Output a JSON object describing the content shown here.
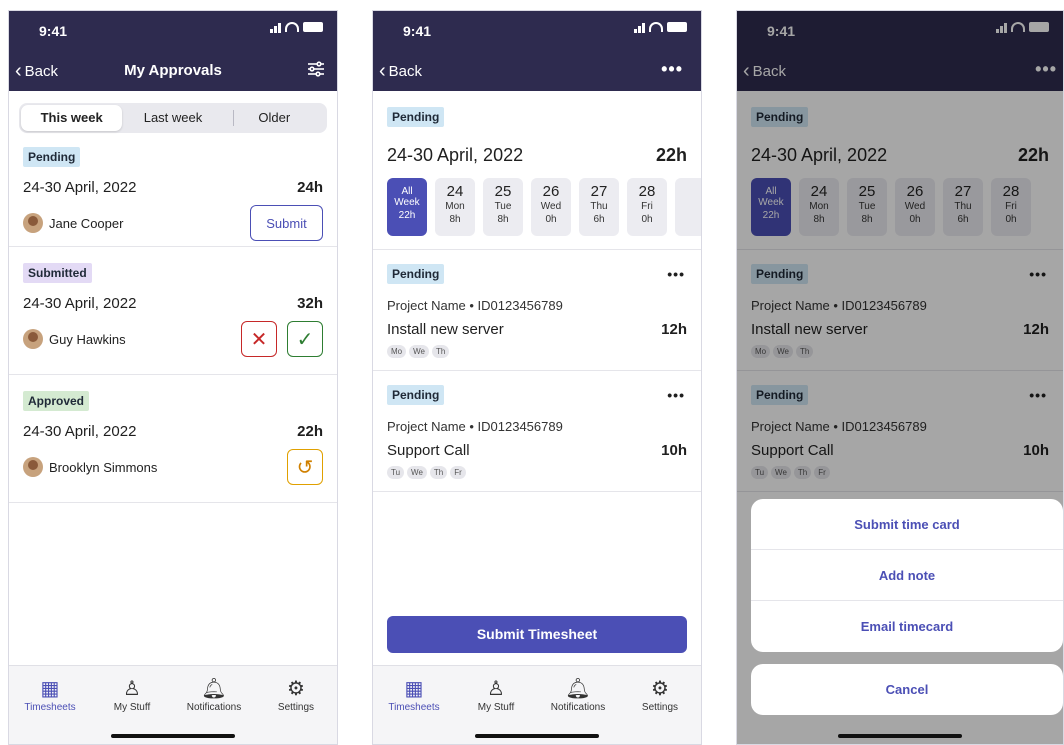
{
  "colors": {
    "navy": "#2e2b4f",
    "accent": "#4b4fb5"
  },
  "status": {
    "time": "9:41"
  },
  "nav": {
    "back": "Back",
    "title": "My Approvals",
    "more": "•••"
  },
  "segments": [
    "This week",
    "Last week",
    "Older"
  ],
  "approvals": [
    {
      "status": "Pending",
      "date": "24-30 April, 2022",
      "hours": "24h",
      "person": "Jane Cooper",
      "action": "Submit"
    },
    {
      "status": "Submitted",
      "date": "24-30 April, 2022",
      "hours": "32h",
      "person": "Guy Hawkins"
    },
    {
      "status": "Approved",
      "date": "24-30 April, 2022",
      "hours": "22h",
      "person": "Brooklyn Simmons"
    }
  ],
  "icons": {
    "filter": "sliders-icon",
    "reject": "close-icon",
    "approve": "check-icon",
    "undo": "undo-icon"
  },
  "tabbar": [
    {
      "label": "Timesheets",
      "icon": "calendar-icon"
    },
    {
      "label": "My Stuff",
      "icon": "person-icon"
    },
    {
      "label": "Notifications",
      "icon": "bell-icon"
    },
    {
      "label": "Settings",
      "icon": "gear-icon"
    }
  ],
  "detail": {
    "status": "Pending",
    "range": "24-30 April, 2022",
    "total": "22h",
    "all": {
      "l1": "All",
      "l2": "Week",
      "h": "22h"
    },
    "days": [
      {
        "n": "24",
        "w": "Mon",
        "h": "8h"
      },
      {
        "n": "25",
        "w": "Tue",
        "h": "8h"
      },
      {
        "n": "26",
        "w": "Wed",
        "h": "0h"
      },
      {
        "n": "27",
        "w": "Thu",
        "h": "6h"
      },
      {
        "n": "28",
        "w": "Fri",
        "h": "0h"
      }
    ],
    "tasks": [
      {
        "status": "Pending",
        "project": "Project Name • ID0123456789",
        "name": "Install new server",
        "hours": "12h",
        "chips": [
          "Mo",
          "We",
          "Th"
        ]
      },
      {
        "status": "Pending",
        "project": "Project Name • ID0123456789",
        "name": "Support Call",
        "hours": "10h",
        "chips": [
          "Tu",
          "We",
          "Th",
          "Fr"
        ]
      }
    ],
    "submit": "Submit Timesheet"
  },
  "sheet": {
    "options": [
      "Submit time card",
      "Add note",
      "Email timecard"
    ],
    "cancel": "Cancel"
  }
}
